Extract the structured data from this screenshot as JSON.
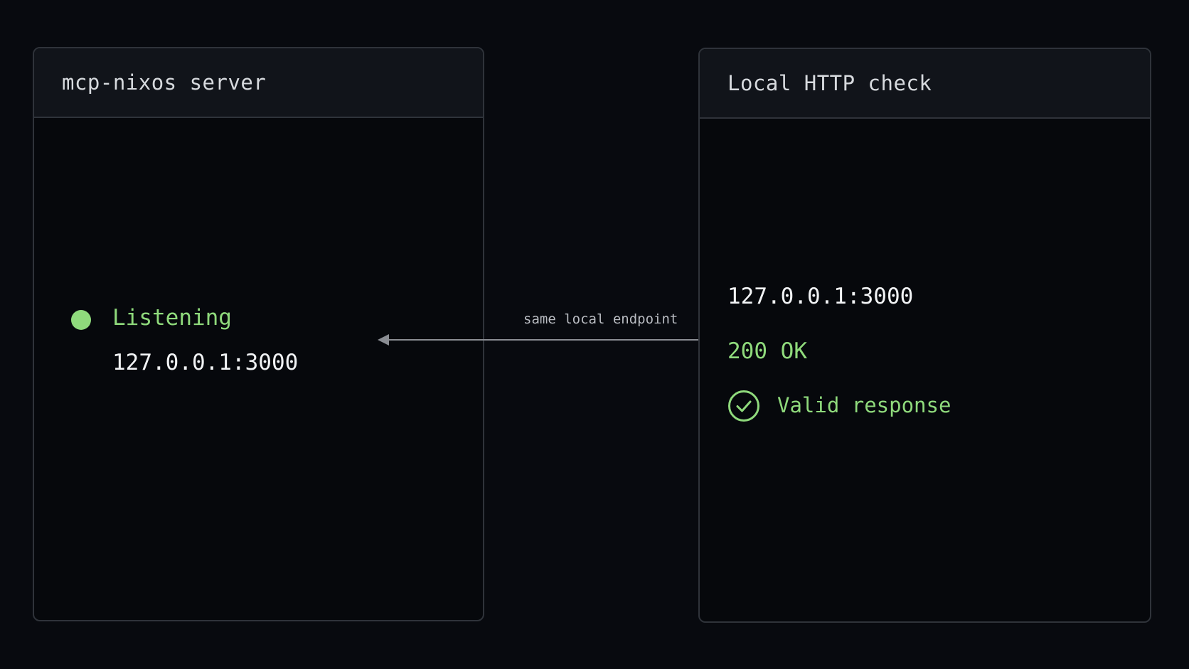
{
  "server_panel": {
    "title": "mcp-nixos server",
    "status_label": "Listening",
    "address": "127.0.0.1:3000"
  },
  "connector": {
    "label": "same local endpoint"
  },
  "check_panel": {
    "title": "Local HTTP check",
    "address": "127.0.0.1:3000",
    "status": "200 OK",
    "result_label": "Valid response",
    "result_icon": "check-circle-icon"
  },
  "colors": {
    "background": "#080a0f",
    "panel_border": "#2f333a",
    "accent_green": "#8fda7c",
    "text_primary": "#f1f3f5",
    "connector_line": "#8a8d93"
  }
}
